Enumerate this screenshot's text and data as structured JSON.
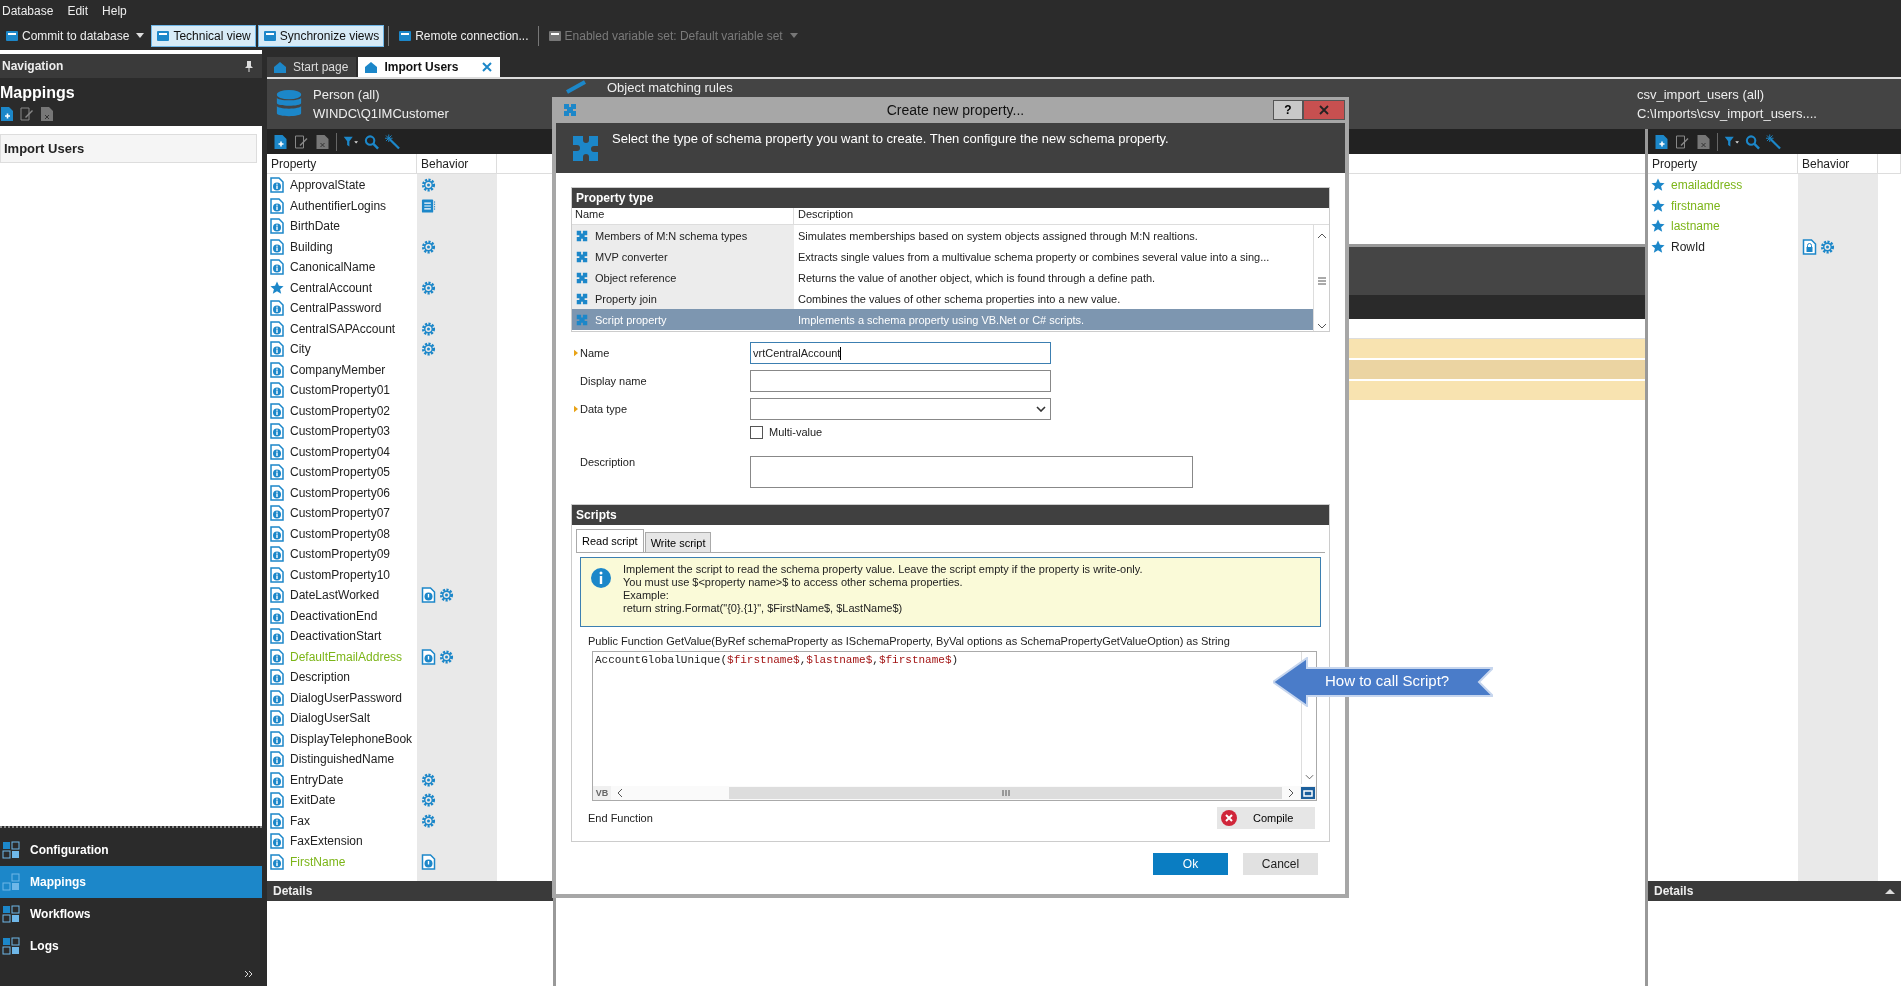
{
  "menu": [
    {
      "label": "Database"
    },
    {
      "label": "Edit"
    },
    {
      "label": "Help"
    }
  ],
  "toolbar": [
    {
      "label": "Commit to database",
      "kind": "dropdown",
      "selected": false,
      "disabled": false
    },
    {
      "label": "Technical view",
      "kind": "toggle",
      "selected": true,
      "disabled": false
    },
    {
      "label": "Synchronize views",
      "kind": "toggle",
      "selected": true,
      "disabled": false
    },
    {
      "label": "Remote connection...",
      "kind": "button",
      "selected": false,
      "disabled": false
    },
    {
      "label": "Enabled variable set: Default variable set",
      "kind": "dropdown",
      "selected": false,
      "disabled": true
    }
  ],
  "navigation": {
    "title": "Navigation",
    "section_title": "Mappings",
    "items": [
      {
        "label": "Import Users",
        "selected": true
      }
    ],
    "modules": [
      {
        "label": "Configuration",
        "selected": false
      },
      {
        "label": "Mappings",
        "selected": true
      },
      {
        "label": "Workflows",
        "selected": false
      },
      {
        "label": "Logs",
        "selected": false
      }
    ]
  },
  "tabs": [
    {
      "label": "Start page",
      "selected": false,
      "closable": false
    },
    {
      "label": "Import Users",
      "selected": true,
      "closable": true
    }
  ],
  "left_header": {
    "title": "Person (all)",
    "subtitle": "WINDC\\Q1IMCustomer"
  },
  "matching_header": {
    "title": "Object matching rules"
  },
  "right_header": {
    "title": "csv_import_users (all)",
    "subtitle": "C:\\Imports\\csv_import_users...."
  },
  "left_table": {
    "columns": [
      "Property",
      "Behavior"
    ],
    "details": "Details",
    "rows": [
      {
        "name": "ApprovalState",
        "kind": "doc",
        "mapped": false,
        "behaviors": [
          {
            "kind": "gear"
          }
        ]
      },
      {
        "name": "AuthentifierLogins",
        "kind": "doc",
        "mapped": false,
        "behaviors": [
          {
            "kind": "list"
          }
        ]
      },
      {
        "name": "BirthDate",
        "kind": "doc",
        "mapped": false
      },
      {
        "name": "Building",
        "kind": "doc",
        "mapped": false,
        "behaviors": [
          {
            "kind": "gear"
          }
        ]
      },
      {
        "name": "CanonicalName",
        "kind": "doc",
        "mapped": false
      },
      {
        "name": "CentralAccount",
        "kind": "star",
        "mapped": false,
        "behaviors": [
          {
            "kind": "gear"
          }
        ]
      },
      {
        "name": "CentralPassword",
        "kind": "doc",
        "mapped": false
      },
      {
        "name": "CentralSAPAccount",
        "kind": "doc",
        "mapped": false,
        "behaviors": [
          {
            "kind": "gear"
          }
        ]
      },
      {
        "name": "City",
        "kind": "doc",
        "mapped": false,
        "behaviors": [
          {
            "kind": "gear"
          }
        ]
      },
      {
        "name": "CompanyMember",
        "kind": "doc",
        "mapped": false
      },
      {
        "name": "CustomProperty01",
        "kind": "doc",
        "mapped": false
      },
      {
        "name": "CustomProperty02",
        "kind": "doc",
        "mapped": false
      },
      {
        "name": "CustomProperty03",
        "kind": "doc",
        "mapped": false
      },
      {
        "name": "CustomProperty04",
        "kind": "doc",
        "mapped": false
      },
      {
        "name": "CustomProperty05",
        "kind": "doc",
        "mapped": false
      },
      {
        "name": "CustomProperty06",
        "kind": "doc",
        "mapped": false
      },
      {
        "name": "CustomProperty07",
        "kind": "doc",
        "mapped": false
      },
      {
        "name": "CustomProperty08",
        "kind": "doc",
        "mapped": false
      },
      {
        "name": "CustomProperty09",
        "kind": "doc",
        "mapped": false
      },
      {
        "name": "CustomProperty10",
        "kind": "doc",
        "mapped": false
      },
      {
        "name": "DateLastWorked",
        "kind": "doc",
        "mapped": false,
        "behaviors": [
          {
            "kind": "doc"
          },
          {
            "kind": "gear"
          }
        ]
      },
      {
        "name": "DeactivationEnd",
        "kind": "doc",
        "mapped": false
      },
      {
        "name": "DeactivationStart",
        "kind": "doc",
        "mapped": false
      },
      {
        "name": "DefaultEmailAddress",
        "kind": "doc",
        "mapped": true,
        "behaviors": [
          {
            "kind": "doc"
          },
          {
            "kind": "gear"
          }
        ]
      },
      {
        "name": "Description",
        "kind": "doc",
        "mapped": false
      },
      {
        "name": "DialogUserPassword",
        "kind": "doc",
        "mapped": false
      },
      {
        "name": "DialogUserSalt",
        "kind": "doc",
        "mapped": false
      },
      {
        "name": "DisplayTelephoneBook",
        "kind": "doc",
        "mapped": false
      },
      {
        "name": "DistinguishedName",
        "kind": "doc",
        "mapped": false
      },
      {
        "name": "EntryDate",
        "kind": "doc",
        "mapped": false,
        "behaviors": [
          {
            "kind": "gear"
          }
        ]
      },
      {
        "name": "ExitDate",
        "kind": "doc",
        "mapped": false,
        "behaviors": [
          {
            "kind": "gear"
          }
        ]
      },
      {
        "name": "Fax",
        "kind": "doc",
        "mapped": false,
        "behaviors": [
          {
            "kind": "gear"
          }
        ]
      },
      {
        "name": "FaxExtension",
        "kind": "doc",
        "mapped": false
      },
      {
        "name": "FirstName",
        "kind": "doc",
        "mapped": true,
        "behaviors": [
          {
            "kind": "doc"
          }
        ]
      }
    ]
  },
  "right_table": {
    "columns": [
      "Property",
      "Behavior"
    ],
    "details": "Details",
    "rows": [
      {
        "name": "emailaddress",
        "kind": "star",
        "mapped": true
      },
      {
        "name": "firstname",
        "kind": "star",
        "mapped": true
      },
      {
        "name": "lastname",
        "kind": "star",
        "mapped": true
      },
      {
        "name": "RowId",
        "kind": "star",
        "mapped": false,
        "behaviors": [
          {
            "kind": "lock"
          },
          {
            "kind": "gear"
          }
        ]
      }
    ]
  },
  "dialog": {
    "title": "Create new property...",
    "help": "?",
    "intro": "Select the type of schema property you want to create. Then configure the new schema property.",
    "type_section": "Property type",
    "type_columns": [
      "Name",
      "Description"
    ],
    "types": [
      {
        "name": "Members of M:N schema types",
        "description": "Simulates memberships based on system objects assigned through M:N realtions.",
        "selected": false
      },
      {
        "name": "MVP converter",
        "description": "Extracts single values from a multivalue schema property or combines several value into a sing...",
        "selected": false
      },
      {
        "name": "Object reference",
        "description": "Returns the value of another object, which is found through a define path.",
        "selected": false
      },
      {
        "name": "Property join",
        "description": "Combines the values of other schema properties into a new value.",
        "selected": false
      },
      {
        "name": "Script property",
        "description": "Implements a schema property using VB.Net or C# scripts.",
        "selected": true
      }
    ],
    "fields": [
      {
        "kind": "text",
        "label": "Name",
        "required": true,
        "value": "vrtCentralAccount",
        "focused": true
      },
      {
        "kind": "text",
        "label": "Display name",
        "required": false,
        "focused": false
      },
      {
        "kind": "select",
        "label": "Data type",
        "required": true,
        "focused": false
      },
      {
        "kind": "checkbox",
        "label": "Multi-value",
        "checked": false
      },
      {
        "kind": "textarea",
        "label": "Description",
        "required": false,
        "focused": false
      }
    ],
    "scripts_section": "Scripts",
    "script_tabs": [
      {
        "label": "Read script",
        "selected": true
      },
      {
        "label": "Write script",
        "selected": false
      }
    ],
    "info": [
      "Implement the script to read the schema property value. Leave the script empty if the property is write-only.",
      "You must use $<property name>$ to access other schema properties.",
      "Example:",
      "return string.Format(\"{0}.{1}\", $FirstName$, $LastName$)"
    ],
    "signature": "Public Function GetValue(ByRef schemaProperty as ISchemaProperty, ByVal options as SchemaPropertyGetValueOption) as String",
    "code": [
      {
        "kind": "plain",
        "text": "AccountGlobalUnique("
      },
      {
        "kind": "variable",
        "text": "$firstname$"
      },
      {
        "kind": "plain",
        "text": ","
      },
      {
        "kind": "variable",
        "text": "$lastname$"
      },
      {
        "kind": "plain",
        "text": ","
      },
      {
        "kind": "variable",
        "text": "$firstname$"
      },
      {
        "kind": "plain",
        "text": ")"
      }
    ],
    "editor_language": "VB",
    "end": "End Function",
    "compile": {
      "label": "Compile",
      "error": true
    },
    "buttons": [
      {
        "label": "Ok",
        "primary": true
      },
      {
        "label": "Cancel",
        "primary": false
      }
    ]
  },
  "callout": {
    "label": "How to call Script?"
  }
}
